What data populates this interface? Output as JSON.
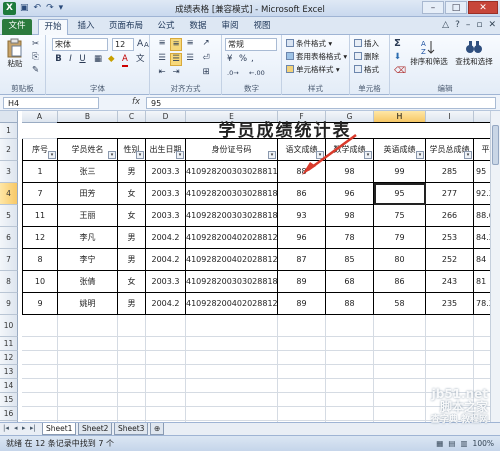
{
  "window": {
    "title": "成绩表格 [兼容模式] - Microsoft Excel",
    "logo": "X",
    "qat": [
      "save-icon",
      "undo-icon",
      "redo-icon"
    ],
    "minimize": "–",
    "maximize": "□",
    "close": "✕"
  },
  "ribbon_tabs": [
    "文件",
    "开始",
    "插入",
    "页面布局",
    "公式",
    "数据",
    "审阅",
    "视图"
  ],
  "ribbon": {
    "clipboard": {
      "paste": "粘贴",
      "label": "剪贴板"
    },
    "font": {
      "name": "宋体",
      "size": "12",
      "bold": "B",
      "italic": "I",
      "underline": "U",
      "grow": "A",
      "shrink": "A",
      "color_a": "A",
      "wen": "文",
      "label": "字体"
    },
    "alignment": {
      "label": "对齐方式"
    },
    "number": {
      "format": "常规",
      "currency": "¥",
      "percent": "%",
      "comma": ",",
      "label": "数字"
    },
    "styles": {
      "conditional": "条件格式",
      "table": "套用表格格式",
      "cell": "单元格样式",
      "label": "样式"
    },
    "cells": {
      "insert": "插入",
      "delete": "删除",
      "format": "格式",
      "label": "单元格"
    },
    "editing": {
      "sigma": "Σ",
      "sort": "排序和筛选",
      "find": "查找和选择",
      "label": "编辑"
    }
  },
  "formula_bar": {
    "name_box": "H4",
    "fx": "fx",
    "value": "95"
  },
  "columns": [
    "A",
    "B",
    "C",
    "D",
    "E",
    "F",
    "G",
    "H",
    "I",
    "J"
  ],
  "rows": [
    "1",
    "2",
    "3",
    "4",
    "5",
    "6",
    "7",
    "8",
    "9",
    "10",
    "11",
    "12",
    "13",
    "14",
    "15",
    "16",
    "17"
  ],
  "selected": {
    "column": "H",
    "row": "4"
  },
  "sheet": {
    "title": "学员成绩统计表",
    "headers": [
      "序号",
      "学员姓名",
      "性别",
      "出生日期",
      "身份证号码",
      "语文成绩",
      "数学成绩",
      "英语成绩",
      "学员总成绩",
      "平均成"
    ],
    "data": [
      [
        "1",
        "张三",
        "男",
        "2003.3",
        "410928200303028811",
        "88",
        "98",
        "99",
        "285",
        "95"
      ],
      [
        "7",
        "田芳",
        "女",
        "2003.3",
        "410928200303028818",
        "86",
        "96",
        "95",
        "277",
        "92.33333"
      ],
      [
        "11",
        "王丽",
        "女",
        "2003.3",
        "410928200303028818",
        "93",
        "98",
        "75",
        "266",
        "88.66666"
      ],
      [
        "12",
        "李凡",
        "男",
        "2004.2",
        "410928200402028812",
        "96",
        "78",
        "79",
        "253",
        "84.33333"
      ],
      [
        "8",
        "李宁",
        "男",
        "2004.2",
        "410928200402028812",
        "87",
        "85",
        "80",
        "252",
        "84"
      ],
      [
        "10",
        "张倩",
        "女",
        "2003.3",
        "410928200303028818",
        "89",
        "68",
        "86",
        "243",
        "81"
      ],
      [
        "9",
        "姚明",
        "男",
        "2004.2",
        "410928200402028812",
        "89",
        "88",
        "58",
        "235",
        "78.33333"
      ]
    ]
  },
  "sheet_tabs": [
    "Sheet1",
    "Sheet2",
    "Sheet3"
  ],
  "status": {
    "text": "就绪  在 12 条记录中找到 7 个",
    "zoom": "100%"
  },
  "watermark": [
    "jb51.net",
    "脚本之家",
    "查字典 教程网"
  ],
  "colors": {
    "accent": "#2b7a3d",
    "arrow": "#d93a2b",
    "selection": "#f7c866"
  }
}
